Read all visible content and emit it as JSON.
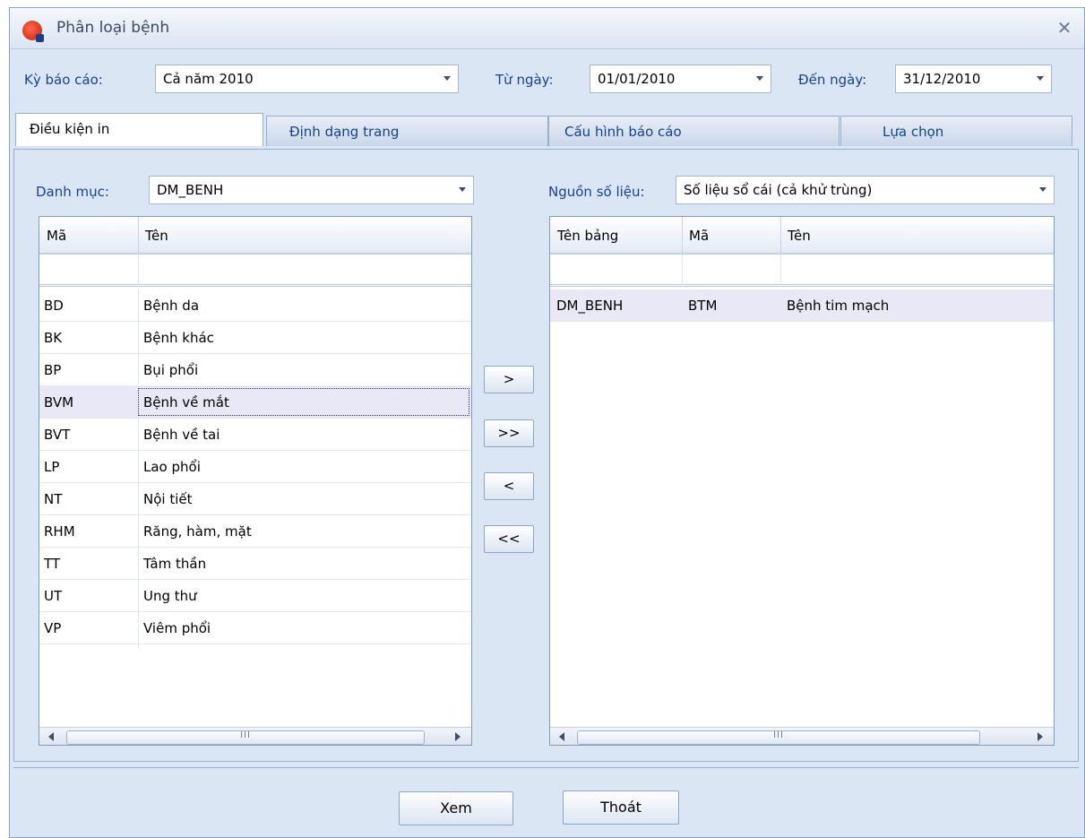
{
  "window": {
    "title": "Phân loại bệnh",
    "close_symbol": "✕"
  },
  "filters": {
    "period_label": "Kỳ báo cáo:",
    "period_value": "Cả năm 2010",
    "from_label": "Từ ngày:",
    "from_value": "01/01/2010",
    "to_label": "Đến ngày:",
    "to_value": "31/12/2010"
  },
  "tabs": [
    {
      "label": "Điều kiện in",
      "active": true
    },
    {
      "label": "Định dạng trang",
      "active": false
    },
    {
      "label": "Cấu hình báo cáo",
      "active": false
    },
    {
      "label": "Lựa chọn",
      "active": false
    }
  ],
  "left": {
    "category_label": "Danh mục:",
    "category_value": "DM_BENH",
    "columns": [
      "Mã",
      "Tên"
    ],
    "rows": [
      {
        "ma": "BD",
        "ten": "Bệnh da"
      },
      {
        "ma": "BK",
        "ten": "Bệnh khác"
      },
      {
        "ma": "BP",
        "ten": "Bụi phổi"
      },
      {
        "ma": "BVM",
        "ten": "Bệnh về mắt"
      },
      {
        "ma": "BVT",
        "ten": "Bệnh về tai"
      },
      {
        "ma": "LP",
        "ten": "Lao phổi"
      },
      {
        "ma": "NT",
        "ten": "Nội tiết"
      },
      {
        "ma": "RHM",
        "ten": "Răng, hàm, mặt"
      },
      {
        "ma": "TT",
        "ten": "Tâm thần"
      },
      {
        "ma": "UT",
        "ten": "Ung thư"
      },
      {
        "ma": "VP",
        "ten": "Viêm phổi"
      }
    ],
    "selected_row": "BVM"
  },
  "right": {
    "source_label": "Nguồn số liệu:",
    "source_value": "Số liệu sổ cái (cả khử trùng)",
    "columns": [
      "Tên bảng",
      "Mã",
      "Tên"
    ],
    "rows": [
      {
        "ten_bang": "DM_BENH",
        "ma": "BTM",
        "ten": "Bệnh tim mạch"
      }
    ]
  },
  "move_buttons": [
    ">",
    ">>",
    "<",
    "<<"
  ],
  "scroll_thumb_glyph": "III",
  "footer": {
    "view_label": "Xem",
    "exit_label": "Thoát"
  },
  "colors": {
    "label_text": "#15428b",
    "window_bg": "#dbe6f4",
    "selected_row": "#e8e8f7"
  }
}
